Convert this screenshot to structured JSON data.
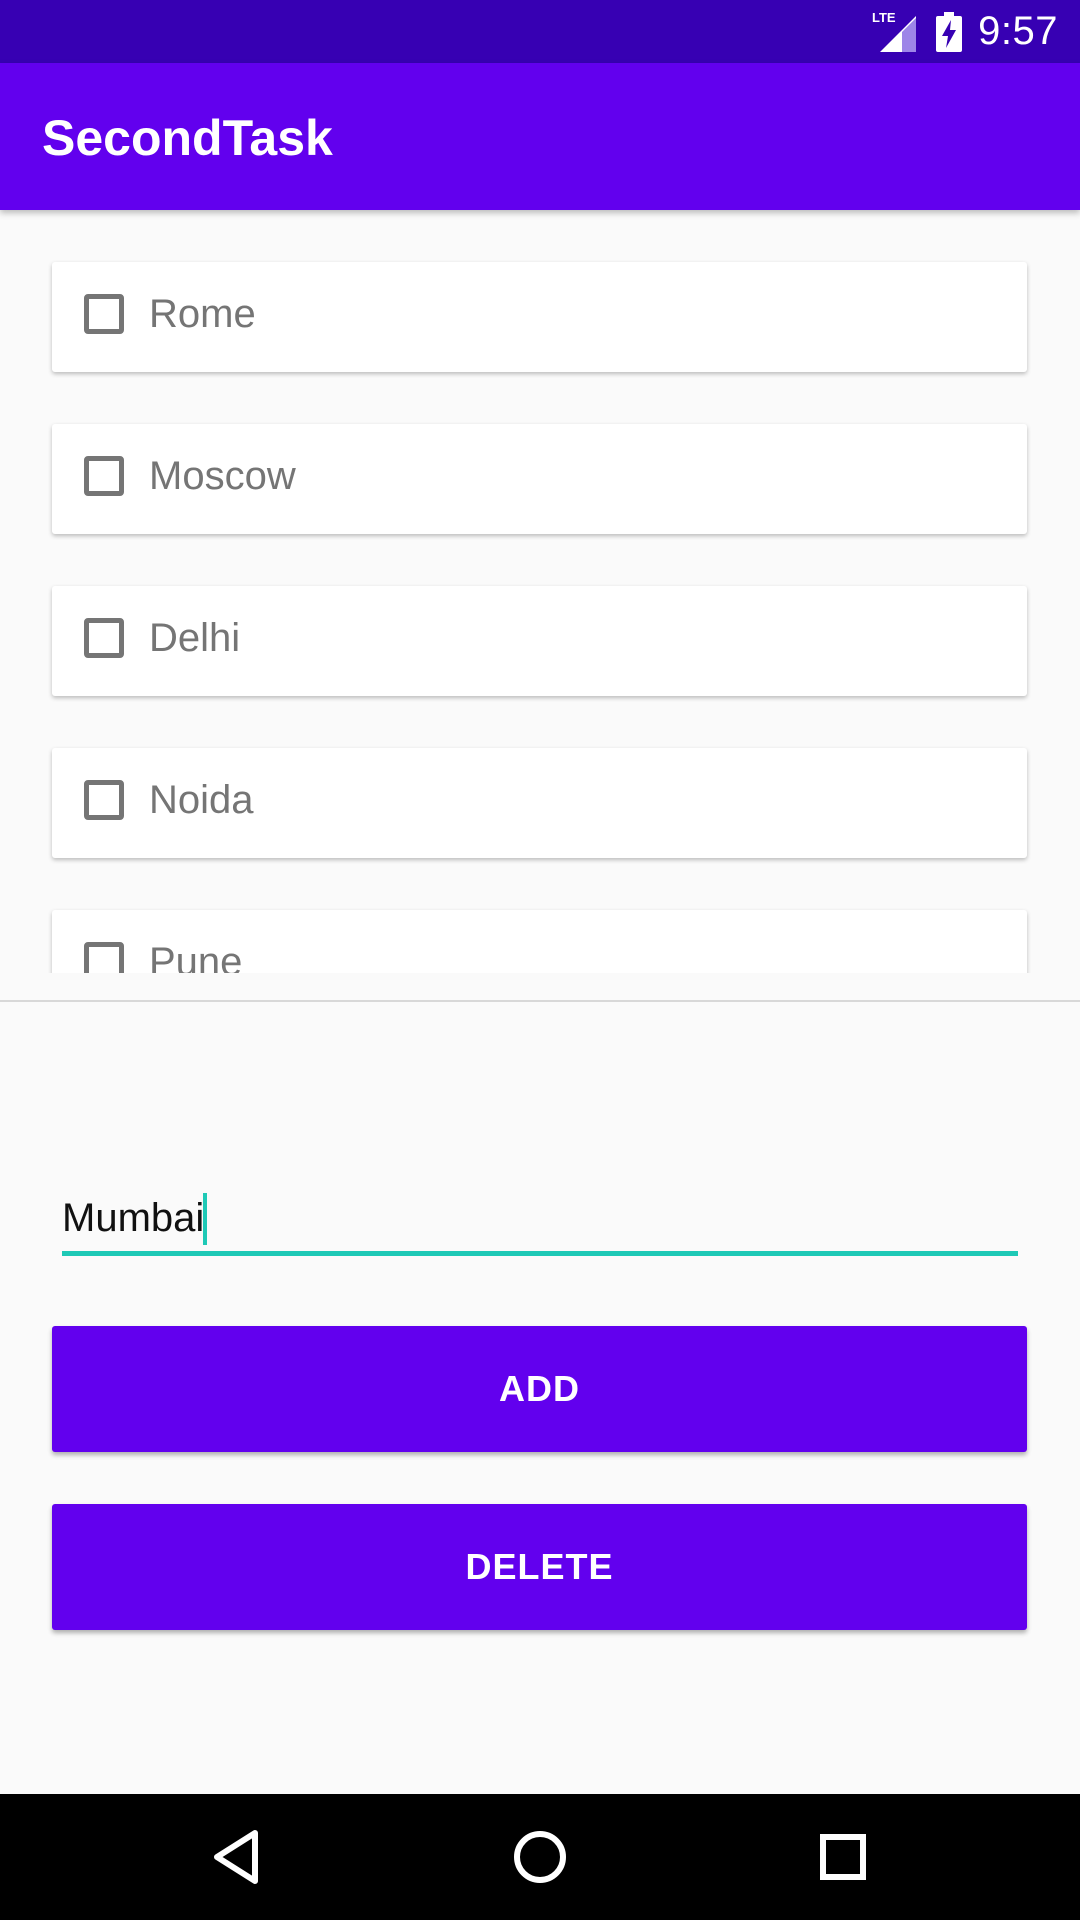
{
  "status_bar": {
    "network_label": "LTE",
    "time": "9:57",
    "icons": [
      "lte-signal-icon",
      "battery-charging-icon"
    ]
  },
  "app_bar": {
    "title": "SecondTask"
  },
  "list": {
    "items": [
      {
        "label": "Rome",
        "checked": false
      },
      {
        "label": "Moscow",
        "checked": false
      },
      {
        "label": "Delhi",
        "checked": false
      },
      {
        "label": "Noida",
        "checked": false
      },
      {
        "label": "Pune",
        "checked": false
      }
    ]
  },
  "input": {
    "value": "Mumbai"
  },
  "buttons": {
    "add_label": "ADD",
    "delete_label": "DELETE"
  },
  "nav_bar": {
    "icons": [
      "back-icon",
      "home-icon",
      "recents-icon"
    ]
  },
  "colors": {
    "status_bar": "#3700b3",
    "primary": "#6200ee",
    "accent": "#1ec9b6",
    "background": "#fafafa"
  }
}
